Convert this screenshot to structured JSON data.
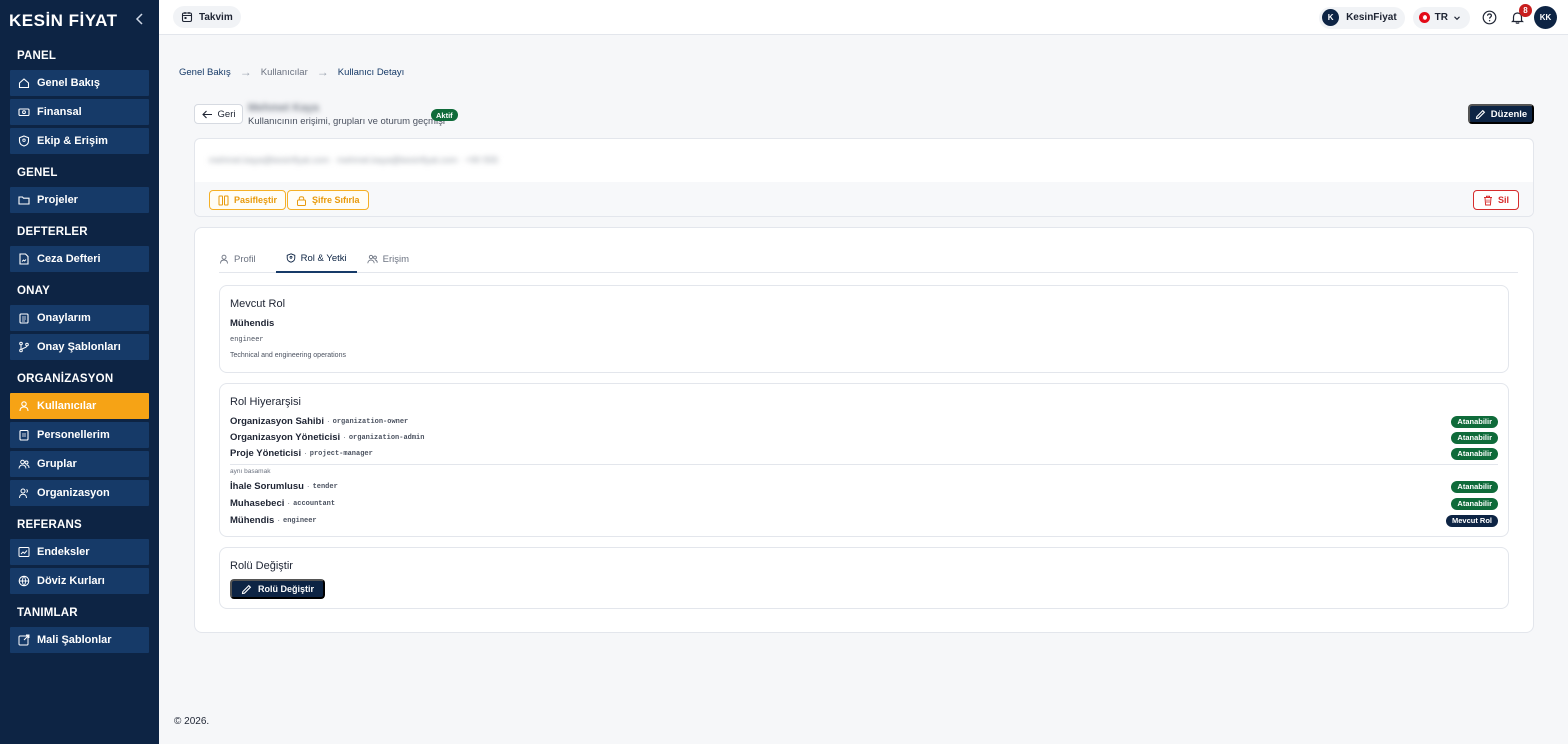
{
  "app": {
    "logo": "KESİN FİYAT"
  },
  "sidebar": {
    "sections": [
      {
        "title": "PANEL",
        "items": [
          "Genel Bakış",
          "Finansal",
          "Ekip & Erişim"
        ]
      },
      {
        "title": "GENEL",
        "items": [
          "Projeler"
        ]
      },
      {
        "title": "DEFTERLER",
        "items": [
          "Ceza Defteri"
        ]
      },
      {
        "title": "ONAY",
        "items": [
          "Onaylarım",
          "Onay Şablonları"
        ]
      },
      {
        "title": "ORGANİZASYON",
        "items": [
          "Kullanıcılar",
          "Personellerim",
          "Gruplar",
          "Organizasyon"
        ]
      },
      {
        "title": "REFERANS",
        "items": [
          "Endeksler",
          "Döviz Kurları"
        ]
      },
      {
        "title": "TANIMLAR",
        "items": [
          "Mali Şablonlar"
        ]
      }
    ],
    "active_item": "Kullanıcılar",
    "active_color": "#f6a315",
    "item_color": "#163a68",
    "bg_color": "#0d2444"
  },
  "topbar": {
    "calendar_label": "Takvim",
    "org_initial": "K",
    "org_name": "KesinFiyat",
    "language": "TR",
    "notification_count": "8",
    "user_initials": "KK"
  },
  "breadcrumb": [
    "Genel Bakış",
    "Kullanıcılar",
    "Kullanıcı Detayı"
  ],
  "header": {
    "back_label": "Geri",
    "user_name": "Mehmet Kaya",
    "subtitle": "Kullanıcının erişimi, grupları ve oturum geçmişi",
    "status": "Aktif",
    "edit_label": "Düzenle"
  },
  "info_card": {
    "contact_line": "mehmet.kaya@kesinfiyat.com · mehmet.kaya@kesinfiyat.com · +90 555",
    "deactivate_label": "Pasifleştir",
    "reset_password_label": "Şifre Sıfırla",
    "delete_label": "Sil"
  },
  "tabs": [
    "Profil",
    "Rol & Yetki",
    "Erişim"
  ],
  "active_tab": "Rol & Yetki",
  "current_role": {
    "title": "Mevcut Rol",
    "name": "Mühendis",
    "key": "engineer",
    "description": "Technical and engineering operations"
  },
  "hierarchy": {
    "title": "Rol Hiyerarşisi",
    "above": [
      {
        "name": "Organizasyon Sahibi",
        "key": "organization-owner",
        "badge": "Atanabilir"
      },
      {
        "name": "Organizasyon Yöneticisi",
        "key": "organization-admin",
        "badge": "Atanabilir"
      },
      {
        "name": "Proje Yöneticisi",
        "key": "project-manager",
        "badge": "Atanabilir"
      }
    ],
    "same_level_label": "aynı basamak",
    "same": [
      {
        "name": "İhale Sorumlusu",
        "key": "tender",
        "badge": "Atanabilir"
      },
      {
        "name": "Muhasebeci",
        "key": "accountant",
        "badge": "Atanabilir"
      },
      {
        "name": "Mühendis",
        "key": "engineer",
        "badge": "Mevcut Rol"
      }
    ]
  },
  "change_role": {
    "title": "Rolü Değiştir",
    "button_label": "Rolü Değiştir"
  },
  "footer": {
    "copyright": "© 2026."
  }
}
